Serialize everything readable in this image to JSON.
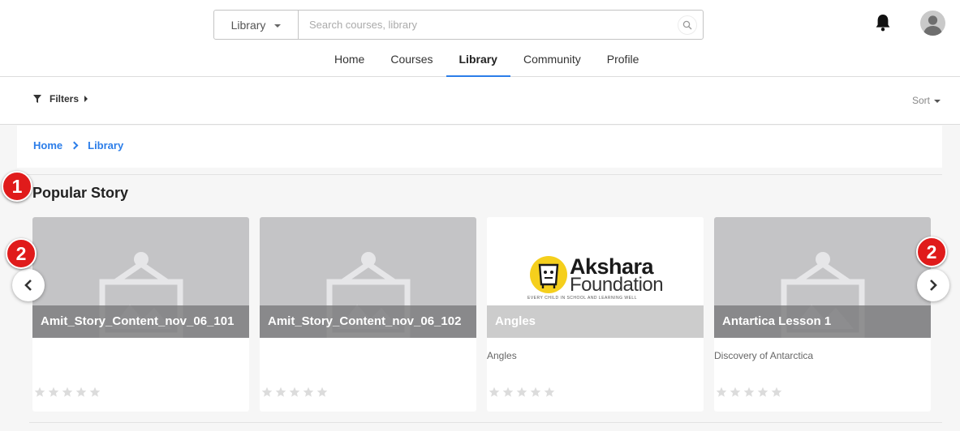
{
  "search": {
    "category": "Library",
    "placeholder": "Search courses, library"
  },
  "nav": {
    "items": [
      "Home",
      "Courses",
      "Library",
      "Community",
      "Profile"
    ],
    "active": "Library"
  },
  "filterbar": {
    "filters_label": "Filters",
    "sort_label": "Sort"
  },
  "breadcrumb": {
    "home": "Home",
    "current": "Library"
  },
  "section": {
    "title": "Popular Story"
  },
  "cards": [
    {
      "title": "Amit_Story_Content_nov_06_101",
      "description": "",
      "thumbnail": "placeholder-image-icon",
      "rating": 0
    },
    {
      "title": "Amit_Story_Content_nov_06_102",
      "description": "",
      "thumbnail": "placeholder-image-icon",
      "rating": 0
    },
    {
      "title": "Angles",
      "description": "Angles",
      "thumbnail": "akshara-foundation-logo",
      "rating": 0,
      "logo": {
        "name": "Akshara",
        "sub": "Foundation",
        "tagline": "EVERY CHILD IN SCHOOL AND LEARNING WELL"
      }
    },
    {
      "title": "Antartica Lesson 1",
      "description": "Discovery of Antarctica",
      "thumbnail": "placeholder-image-icon",
      "rating": 0
    }
  ],
  "markers": [
    "1",
    "2",
    "2"
  ],
  "colors": {
    "accent": "#2b7de9",
    "marker": "#e01b1b",
    "star": "#dcdcdc"
  }
}
